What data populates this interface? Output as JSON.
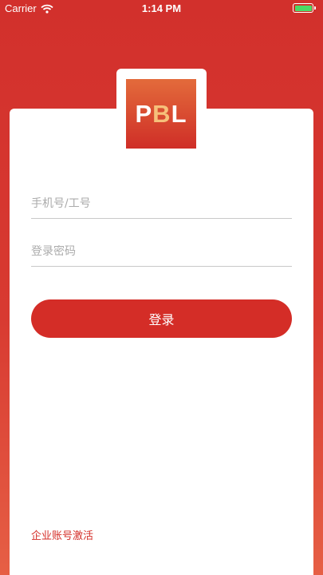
{
  "status_bar": {
    "carrier": "Carrier",
    "time": "1:14 PM",
    "wifi_icon": "wifi-icon",
    "battery_icon": "battery-icon"
  },
  "logo": {
    "left": "P",
    "middle": "B",
    "right": "L"
  },
  "form": {
    "phone_placeholder": "手机号/工号",
    "password_placeholder": "登录密码",
    "phone_value": "",
    "password_value": ""
  },
  "actions": {
    "login_label": "登录",
    "activate_label": "企业账号激活"
  },
  "colors": {
    "brand_red": "#d42d27",
    "background_top": "#d2302c",
    "background_bottom": "#e65f45"
  }
}
